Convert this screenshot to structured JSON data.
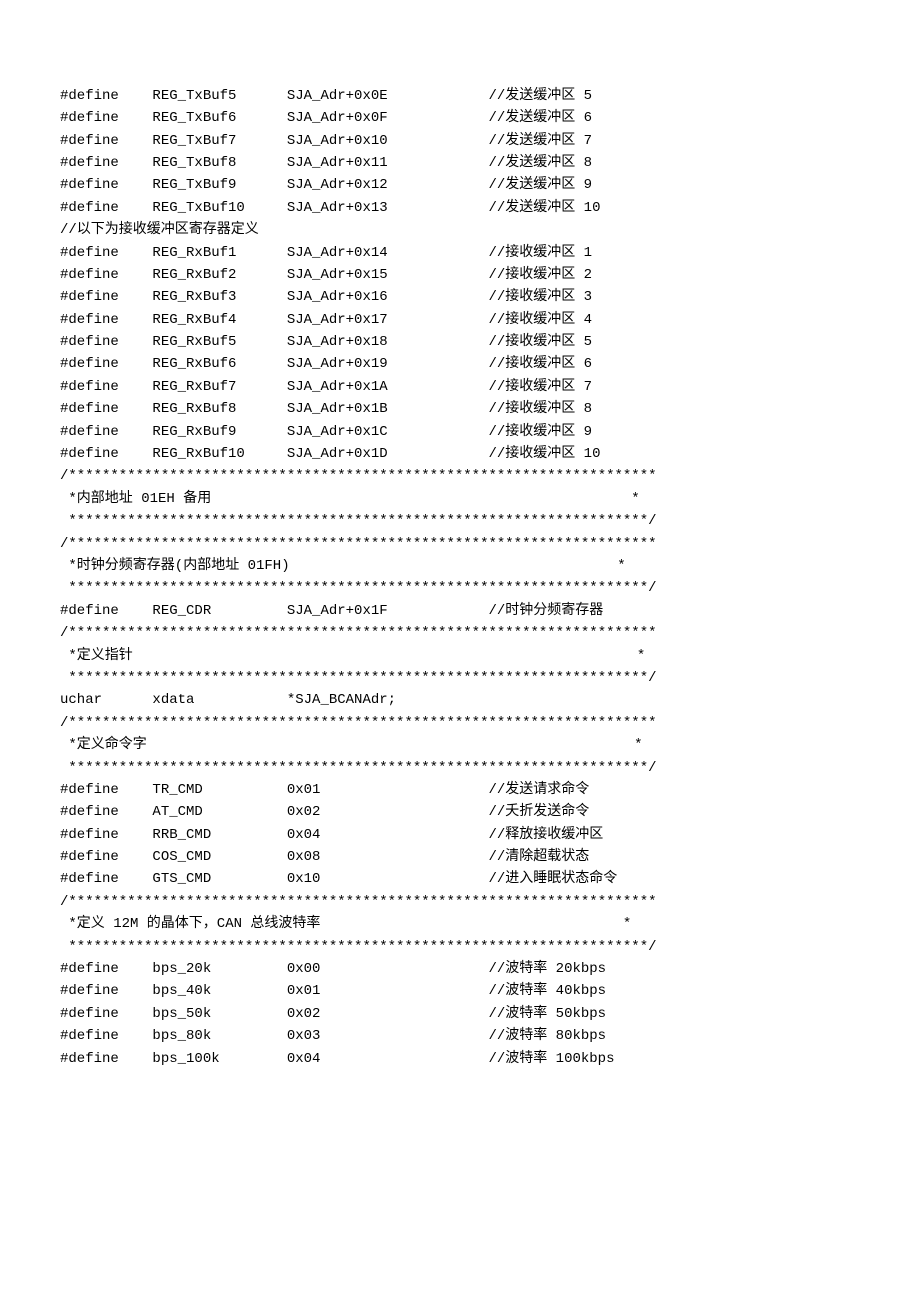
{
  "lines": [
    "#define    REG_TxBuf5      SJA_Adr+0x0E            //发送缓冲区 5",
    "#define    REG_TxBuf6      SJA_Adr+0x0F            //发送缓冲区 6",
    "#define    REG_TxBuf7      SJA_Adr+0x10            //发送缓冲区 7",
    "#define    REG_TxBuf8      SJA_Adr+0x11            //发送缓冲区 8",
    "#define    REG_TxBuf9      SJA_Adr+0x12            //发送缓冲区 9",
    "#define    REG_TxBuf10     SJA_Adr+0x13            //发送缓冲区 10",
    "//以下为接收缓冲区寄存器定义",
    "#define    REG_RxBuf1      SJA_Adr+0x14            //接收缓冲区 1",
    "#define    REG_RxBuf2      SJA_Adr+0x15            //接收缓冲区 2",
    "#define    REG_RxBuf3      SJA_Adr+0x16            //接收缓冲区 3",
    "#define    REG_RxBuf4      SJA_Adr+0x17            //接收缓冲区 4",
    "#define    REG_RxBuf5      SJA_Adr+0x18            //接收缓冲区 5",
    "#define    REG_RxBuf6      SJA_Adr+0x19            //接收缓冲区 6",
    "#define    REG_RxBuf7      SJA_Adr+0x1A            //接收缓冲区 7",
    "#define    REG_RxBuf8      SJA_Adr+0x1B            //接收缓冲区 8",
    "#define    REG_RxBuf9      SJA_Adr+0x1C            //接收缓冲区 9",
    "#define    REG_RxBuf10     SJA_Adr+0x1D            //接收缓冲区 10",
    "/**********************************************************************",
    " *内部地址 01EH 备用                                                  *",
    " *********************************************************************/",
    "/**********************************************************************",
    " *时钟分频寄存器(内部地址 01FH)                                       *",
    " *********************************************************************/",
    "#define    REG_CDR         SJA_Adr+0x1F            //时钟分频寄存器",
    "/**********************************************************************",
    " *定义指针                                                            *",
    " *********************************************************************/",
    "uchar      xdata           *SJA_BCANAdr;",
    "/**********************************************************************",
    " *定义命令字                                                          *",
    " *********************************************************************/",
    "#define    TR_CMD          0x01                    //发送请求命令",
    "#define    AT_CMD          0x02                    //夭折发送命令",
    "#define    RRB_CMD         0x04                    //释放接收缓冲区",
    "#define    COS_CMD         0x08                    //清除超载状态",
    "#define    GTS_CMD         0x10                    //进入睡眠状态命令",
    "/**********************************************************************",
    " *定义 12M 的晶体下，CAN 总线波特率                                    *",
    " *********************************************************************/",
    "#define    bps_20k         0x00                    //波特率 20kbps",
    "#define    bps_40k         0x01                    //波特率 40kbps",
    "#define    bps_50k         0x02                    //波特率 50kbps",
    "#define    bps_80k         0x03                    //波特率 80kbps",
    "#define    bps_100k        0x04                    //波特率 100kbps"
  ]
}
